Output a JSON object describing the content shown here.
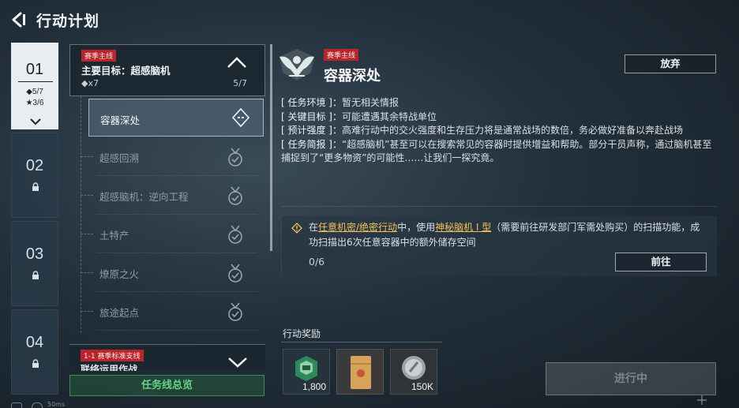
{
  "header": {
    "title": "行动计划"
  },
  "chapters": [
    {
      "num": "01",
      "diamonds": "◆5/7",
      "stars": "★3/6"
    },
    {
      "num": "02"
    },
    {
      "num": "03"
    },
    {
      "num": "04"
    }
  ],
  "quest_group": {
    "tag": "赛季主线",
    "title": "主要目标：超感脑机",
    "count": "◆x7",
    "progress": "5/7"
  },
  "quest_items": [
    {
      "label": "容器深处"
    },
    {
      "label": "超感回溯"
    },
    {
      "label": "超感脑机：逆向工程"
    },
    {
      "label": "土特产"
    },
    {
      "label": "燎原之火"
    },
    {
      "label": "旅途起点"
    }
  ],
  "quest_group2": {
    "tag": "1-1 赛季标准支线",
    "title": "联络运用作战"
  },
  "overview_button": "任务线总览",
  "mission": {
    "tag": "赛季主线",
    "title": "容器深处",
    "abandon": "放弃",
    "env_key": "[ 任务环境 ]：",
    "env_val": "暂无相关情报",
    "target_key": "[ 关键目标 ]：",
    "target_val": "可能遭遇其余特战单位",
    "intensity_key": "[ 预计强度 ]：",
    "intensity_val": "高难行动中的交火强度和生存压力将是通常战场的数倍，务必做好准备以奔赴战场",
    "brief_key": "[ 任务简报 ]：",
    "brief_val": "“超感脑机”甚至可以在搜索常见的容器时提供增益和帮助。部分干员声称，通过脑机甚至捕捉到了“更多物资”的可能性……让我们一探究竟。"
  },
  "scan_task": {
    "pre": "在",
    "mode": "任意机密/绝密行动",
    "mid": "中，使用",
    "item": "神秘脑机 I 型",
    "post": "（需要前往研发部门军需处购买）的扫描功能，成功扫描出6次任意容器中的额外储存空间",
    "progress": "0/6",
    "goto": "前往"
  },
  "rewards": {
    "title": "行动奖励",
    "items": [
      {
        "icon": "green-box-icon",
        "qty": "1,800"
      },
      {
        "icon": "document-packet-icon",
        "qty": ""
      },
      {
        "icon": "silver-coin-icon",
        "qty": "150K"
      }
    ]
  },
  "status_button": "进行中",
  "footer": {
    "text": "50ms"
  },
  "colors": {
    "accent_red": "#b8262b",
    "highlight_gold": "#f0c15a",
    "overview_green": "#63d18a"
  }
}
